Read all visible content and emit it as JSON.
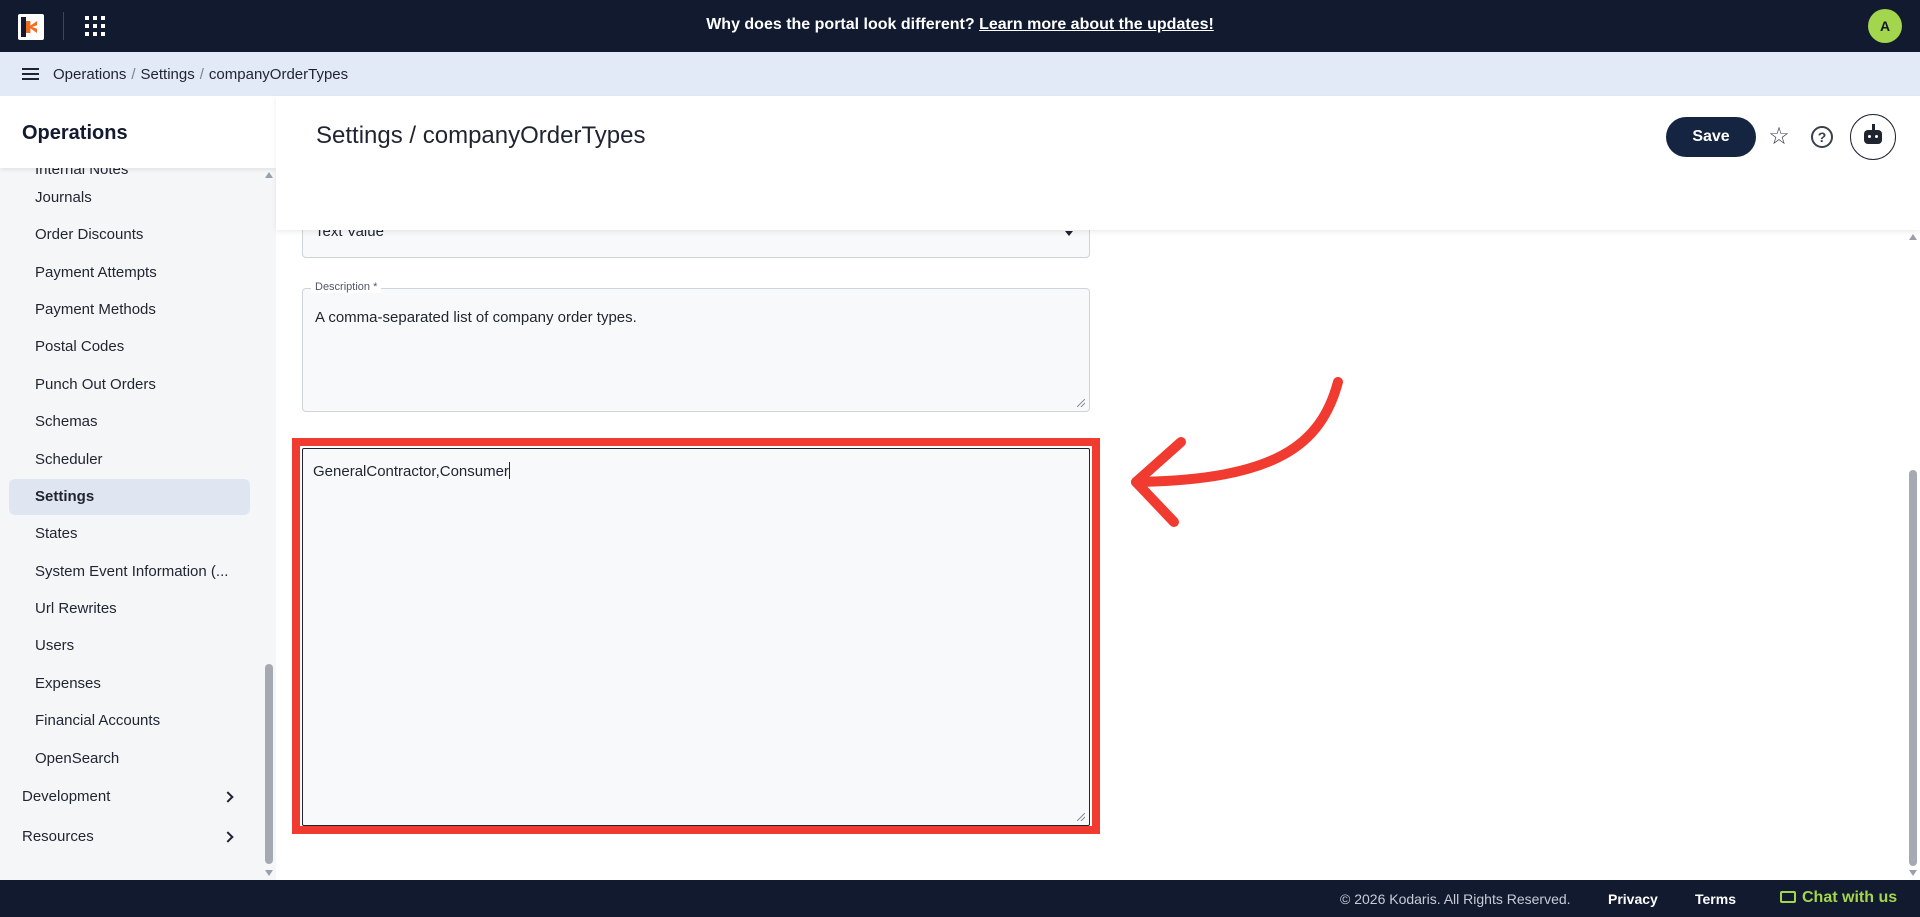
{
  "topbar": {
    "announcement_text": "Why does the portal look different?",
    "announcement_link": "Learn more about the updates!",
    "avatar_initial": "A"
  },
  "breadcrumb": {
    "items": [
      "Operations",
      "Settings",
      "companyOrderTypes"
    ],
    "separator": "/"
  },
  "sidebar": {
    "title": "Operations",
    "items": [
      {
        "label": "Internal Notes"
      },
      {
        "label": "Journals"
      },
      {
        "label": "Order Discounts"
      },
      {
        "label": "Payment Attempts"
      },
      {
        "label": "Payment Methods"
      },
      {
        "label": "Postal Codes"
      },
      {
        "label": "Punch Out Orders"
      },
      {
        "label": "Schemas"
      },
      {
        "label": "Scheduler"
      },
      {
        "label": "Settings"
      },
      {
        "label": "States"
      },
      {
        "label": "System Event Information (..."
      },
      {
        "label": "Url Rewrites"
      },
      {
        "label": "Users"
      },
      {
        "label": "Expenses"
      },
      {
        "label": "Financial Accounts"
      },
      {
        "label": "OpenSearch"
      }
    ],
    "active_item": "Settings",
    "groups": [
      {
        "label": "Development"
      },
      {
        "label": "Resources"
      }
    ]
  },
  "main": {
    "page_title": "Settings / companyOrderTypes",
    "save_label": "Save",
    "type_select_value": "Text Value",
    "description_label": "Description *",
    "description_value": "A comma-separated list of company order types.",
    "value_text": "GeneralContractor,Consumer"
  },
  "footer": {
    "copyright": "© 2026 Kodaris. All Rights Reserved.",
    "privacy": "Privacy",
    "terms": "Terms",
    "chat": "Chat with us"
  },
  "colors": {
    "topbar_bg": "#111a2e",
    "accent_green": "#a3d64d",
    "save_button": "#142441",
    "highlight_red": "#f13a30"
  },
  "icons": [
    "kodaris-logo-icon",
    "apps-grid-icon",
    "menu-icon",
    "star-icon",
    "help-icon",
    "bot-icon",
    "chevron-right-icon",
    "chat-icon",
    "curved-arrow-icon"
  ]
}
